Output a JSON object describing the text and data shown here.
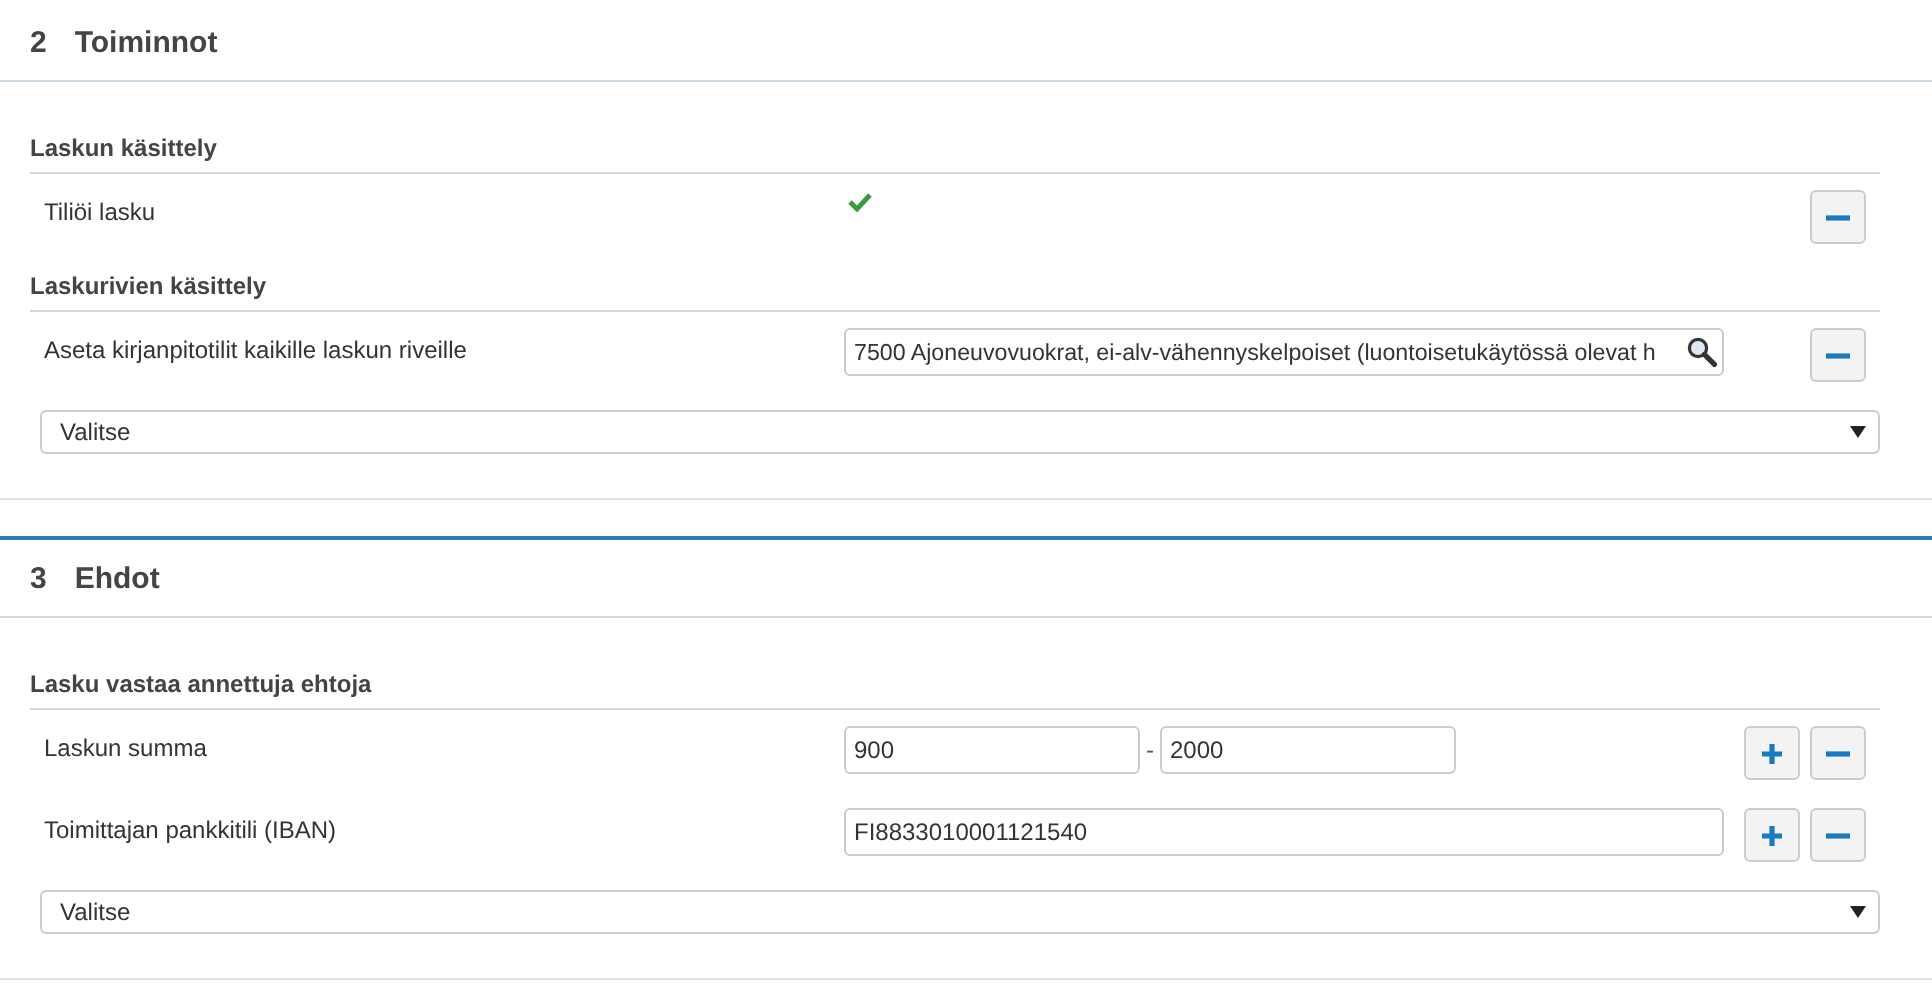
{
  "sections": [
    {
      "number": "2",
      "title": "Toiminnot",
      "accent": false,
      "groups": [
        {
          "title": "Laskun käsittely",
          "rows": [
            {
              "kind": "check",
              "label": "Tiliöi lasku",
              "checked": true,
              "actions": [
                {
                  "kind": "remove"
                }
              ]
            }
          ]
        },
        {
          "title": "Laskurivien käsittely",
          "rows": [
            {
              "kind": "lookup",
              "label": "Aseta kirjanpitotilit kaikille laskun riveille",
              "value": "7500 Ajoneuvovuokrat, ei-alv-vähennyskelpoiset (luontoisetukäytössä olevat h",
              "actions": [
                {
                  "kind": "remove"
                }
              ]
            }
          ]
        }
      ],
      "select": {
        "value": "Valitse"
      }
    },
    {
      "number": "3",
      "title": "Ehdot",
      "accent": true,
      "groups": [
        {
          "title": "Lasku vastaa annettuja ehtoja",
          "rows": [
            {
              "kind": "range",
              "label": "Laskun summa",
              "from": "900",
              "separator": "-",
              "to": "2000",
              "actions": [
                {
                  "kind": "add"
                },
                {
                  "kind": "remove"
                }
              ]
            },
            {
              "kind": "text",
              "label": "Toimittajan pankkitili (IBAN)",
              "value": "FI8833010001121540",
              "actions": [
                {
                  "kind": "add"
                },
                {
                  "kind": "remove"
                }
              ]
            }
          ]
        }
      ],
      "select": {
        "value": "Valitse"
      }
    }
  ]
}
